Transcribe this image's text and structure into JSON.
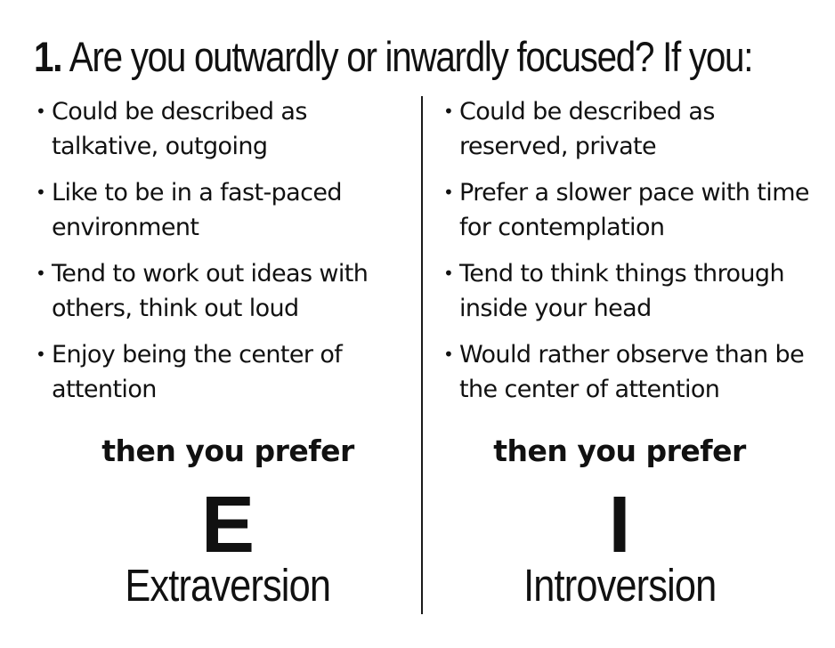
{
  "question": {
    "number": "1.",
    "text": "Are you outwardly or inwardly focused? If you:"
  },
  "left": {
    "items": [
      "Could be described as talkative, outgoing",
      "Like to be in a fast-paced environment",
      "Tend to work out ideas with others, think out loud",
      "Enjoy being the center of attention"
    ],
    "prefer_text": "then you prefer",
    "letter": "E",
    "type_name": "Extraversion"
  },
  "right": {
    "items": [
      "Could be described as reserved, private",
      "Prefer a slower pace with time for contemplation",
      "Tend to think things through inside your head",
      "Would rather observe than be the center of attention"
    ],
    "prefer_text": "then you prefer",
    "letter": "I",
    "type_name": "Introversion"
  },
  "bullet_glyph": "•"
}
